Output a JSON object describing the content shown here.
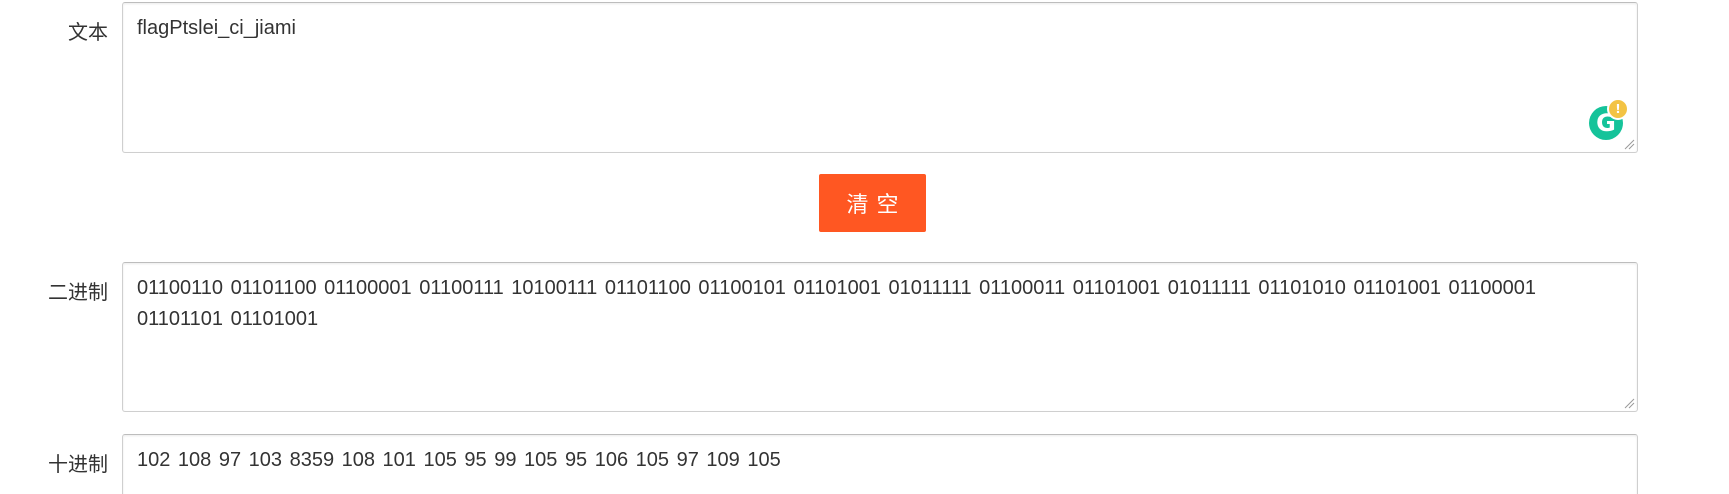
{
  "text_row": {
    "label": "文本",
    "value": "flagPtslei_ci_jiami"
  },
  "clear_button": {
    "label": "清空"
  },
  "binary_row": {
    "label": "二进制",
    "value": "01100110 01101100 01100001 01100111 10100111 01101100 01100101 01101001 01011111 01100011 01101001 01011111 01101010 01101001 01100001 01101101 01101001"
  },
  "decimal_row": {
    "label": "十进制",
    "value": "102 108 97 103 8359 108 101 105 95 99 105 95 106 105 97 109 105"
  },
  "icons": {
    "grammarly": "grammarly-icon",
    "grammarly_badge": "alert-badge-icon",
    "resize": "resize-grip-icon"
  },
  "colors": {
    "accent": "#ff5722",
    "grammarly": "#15c39a",
    "badge": "#f3c344"
  }
}
